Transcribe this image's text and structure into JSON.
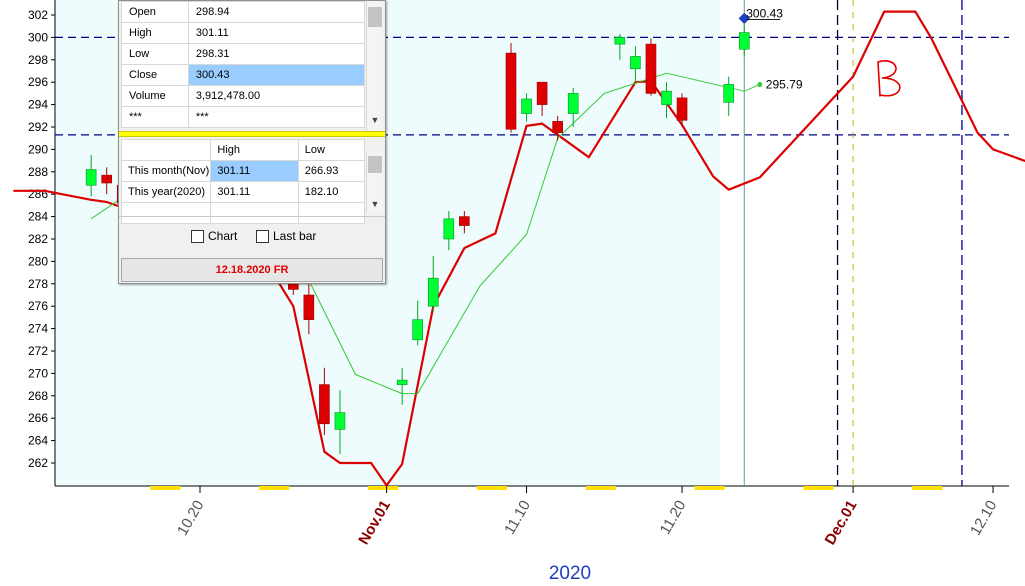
{
  "chart_data": {
    "type": "candlestick",
    "ylim": [
      260,
      302
    ],
    "y_ticks": [
      302,
      300,
      298,
      296,
      294,
      292,
      290,
      288,
      286,
      284,
      282,
      280,
      278,
      276,
      274,
      272,
      270,
      268,
      266,
      264,
      262
    ],
    "x_tick_labels": [
      {
        "label": "10.20",
        "date": "2020-10-20",
        "type": "day"
      },
      {
        "label": "Nov.01",
        "date": "2020-11-01",
        "type": "month"
      },
      {
        "label": "11.10",
        "date": "2020-11-10",
        "type": "day"
      },
      {
        "label": "11.20",
        "date": "2020-11-20",
        "type": "day"
      },
      {
        "label": "Dec.01",
        "date": "2020-12-01",
        "type": "month"
      },
      {
        "label": "12.10",
        "date": "2020-12-10",
        "type": "day"
      }
    ],
    "year_label": "2020",
    "candles": [
      {
        "date": "2020-10-13",
        "open": 286.8,
        "high": 289.5,
        "low": 285.8,
        "close": 288.2,
        "dir": "up"
      },
      {
        "date": "2020-10-14",
        "open": 287.7,
        "high": 288.4,
        "low": 286.0,
        "close": 287.0,
        "dir": "down"
      },
      {
        "date": "2020-10-15",
        "open": 286.8,
        "high": 287.5,
        "low": 284.8,
        "close": 285.2,
        "dir": "down"
      },
      {
        "date": "2020-10-26",
        "open": 279.0,
        "high": 280.5,
        "low": 277.0,
        "close": 277.5,
        "dir": "down"
      },
      {
        "date": "2020-10-27",
        "open": 277.0,
        "high": 278.0,
        "low": 273.5,
        "close": 274.8,
        "dir": "down"
      },
      {
        "date": "2020-10-28",
        "open": 269.0,
        "high": 270.5,
        "low": 264.5,
        "close": 265.5,
        "dir": "down"
      },
      {
        "date": "2020-10-29",
        "open": 265.0,
        "high": 268.5,
        "low": 262.8,
        "close": 266.5,
        "dir": "up"
      },
      {
        "date": "2020-11-02",
        "open": 269.0,
        "high": 270.5,
        "low": 267.2,
        "close": 269.4,
        "dir": "up"
      },
      {
        "date": "2020-11-03",
        "open": 273.0,
        "high": 276.5,
        "low": 272.5,
        "close": 274.8,
        "dir": "up"
      },
      {
        "date": "2020-11-04",
        "open": 276.0,
        "high": 280.5,
        "low": 275.5,
        "close": 278.5,
        "dir": "up"
      },
      {
        "date": "2020-11-05",
        "open": 282.0,
        "high": 284.5,
        "low": 281.0,
        "close": 283.8,
        "dir": "up"
      },
      {
        "date": "2020-11-06",
        "open": 284.0,
        "high": 284.5,
        "low": 282.5,
        "close": 283.2,
        "dir": "down"
      },
      {
        "date": "2020-11-09",
        "open": 298.6,
        "high": 299.5,
        "low": 291.5,
        "close": 291.8,
        "dir": "down"
      },
      {
        "date": "2020-11-10",
        "open": 293.2,
        "high": 295.0,
        "low": 292.5,
        "close": 294.5,
        "dir": "up"
      },
      {
        "date": "2020-11-11",
        "open": 296.0,
        "high": 296.0,
        "low": 293.0,
        "close": 294.0,
        "dir": "down"
      },
      {
        "date": "2020-11-12",
        "open": 292.5,
        "high": 293.0,
        "low": 290.8,
        "close": 291.5,
        "dir": "down"
      },
      {
        "date": "2020-11-13",
        "open": 293.2,
        "high": 295.5,
        "low": 292.0,
        "close": 295.0,
        "dir": "up"
      },
      {
        "date": "2020-11-16",
        "open": 299.4,
        "high": 300.3,
        "low": 298.0,
        "close": 300.0,
        "dir": "up"
      },
      {
        "date": "2020-11-17",
        "open": 297.2,
        "high": 299.2,
        "low": 296.0,
        "close": 298.3,
        "dir": "up"
      },
      {
        "date": "2020-11-18",
        "open": 299.4,
        "high": 299.9,
        "low": 294.8,
        "close": 295.0,
        "dir": "down"
      },
      {
        "date": "2020-11-19",
        "open": 294.0,
        "high": 296.0,
        "low": 292.8,
        "close": 295.2,
        "dir": "up"
      },
      {
        "date": "2020-11-20",
        "open": 294.6,
        "high": 295.0,
        "low": 292.0,
        "close": 292.6,
        "dir": "down"
      },
      {
        "date": "2020-11-23",
        "open": 294.2,
        "high": 296.5,
        "low": 293.0,
        "close": 295.8,
        "dir": "up"
      },
      {
        "date": "2020-11-24",
        "open": 298.94,
        "high": 301.11,
        "low": 298.31,
        "close": 300.43,
        "dir": "up"
      }
    ],
    "moving_average": [
      {
        "date": "2020-10-13",
        "value": 283.8
      },
      {
        "date": "2020-10-15",
        "value": 285.7
      },
      {
        "date": "2020-10-27",
        "value": 278.3
      },
      {
        "date": "2020-10-30",
        "value": 269.9
      },
      {
        "date": "2020-11-02",
        "value": 268.2
      },
      {
        "date": "2020-11-03",
        "value": 268.2
      },
      {
        "date": "2020-11-07",
        "value": 277.8
      },
      {
        "date": "2020-11-10",
        "value": 282.4
      },
      {
        "date": "2020-11-12",
        "value": 291.0
      },
      {
        "date": "2020-11-15",
        "value": 295.0
      },
      {
        "date": "2020-11-19",
        "value": 296.8
      },
      {
        "date": "2020-11-24",
        "value": 295.2
      },
      {
        "date": "2020-11-25",
        "value": 295.79
      }
    ],
    "cycle_projection": [
      {
        "date": "2020-10-08",
        "value": 286.3
      },
      {
        "date": "2020-10-10",
        "value": 286.3
      },
      {
        "date": "2020-10-13",
        "value": 285.5
      },
      {
        "date": "2020-10-14",
        "value": 285.3
      },
      {
        "date": "2020-10-24",
        "value": 280.5
      },
      {
        "date": "2020-10-26",
        "value": 276.0
      },
      {
        "date": "2020-10-28",
        "value": 263.0
      },
      {
        "date": "2020-10-29",
        "value": 262.0
      },
      {
        "date": "2020-10-31",
        "value": 262.0
      },
      {
        "date": "2020-11-01",
        "value": 260.0
      },
      {
        "date": "2020-11-02",
        "value": 261.9
      },
      {
        "date": "2020-11-04",
        "value": 276.0
      },
      {
        "date": "2020-11-06",
        "value": 281.2
      },
      {
        "date": "2020-11-08",
        "value": 282.5
      },
      {
        "date": "2020-11-10",
        "value": 292.1
      },
      {
        "date": "2020-11-11",
        "value": 292.3
      },
      {
        "date": "2020-11-14",
        "value": 289.3
      },
      {
        "date": "2020-11-17",
        "value": 296.0
      },
      {
        "date": "2020-11-18",
        "value": 296.1
      },
      {
        "date": "2020-11-20",
        "value": 292.2
      },
      {
        "date": "2020-11-22",
        "value": 287.6
      },
      {
        "date": "2020-11-23",
        "value": 286.4
      },
      {
        "date": "2020-11-25",
        "value": 287.5
      },
      {
        "date": "2020-11-28",
        "value": 292.0
      },
      {
        "date": "2020-12-01",
        "value": 296.5
      },
      {
        "date": "2020-12-03",
        "value": 302.3
      },
      {
        "date": "2020-12-05",
        "value": 302.3
      },
      {
        "date": "2020-12-06",
        "value": 300.0
      },
      {
        "date": "2020-12-09",
        "value": 291.5
      },
      {
        "date": "2020-12-10",
        "value": 290.0
      },
      {
        "date": "2020-12-13",
        "value": 288.5
      },
      {
        "date": "2020-12-15",
        "value": 286.0
      },
      {
        "date": "2020-12-17",
        "value": 284.0
      },
      {
        "date": "2020-12-18",
        "value": 283.8
      },
      {
        "date": "2020-12-20",
        "value": 284.4
      },
      {
        "date": "2020-12-24",
        "value": 287.0
      }
    ],
    "horizontal_lines": [
      300.0,
      291.3
    ],
    "vertical_lines": [
      "2020-11-24",
      "2020-11-30",
      "2020-12-08"
    ],
    "dashed_vertical_lines": [
      "2020-12-01"
    ],
    "last_close_label": "300.43",
    "ma_label": "295.79",
    "annotation": "B"
  },
  "info_panel": {
    "rows": [
      {
        "label": "Open",
        "value": "298.94"
      },
      {
        "label": "High",
        "value": "301.11"
      },
      {
        "label": "Low",
        "value": "298.31"
      },
      {
        "label": "Close",
        "value": "300.43"
      },
      {
        "label": "Volume",
        "value": "3,912,478.00"
      },
      {
        "label": "***",
        "value": "***"
      }
    ],
    "range_headers": [
      "High",
      "Low"
    ],
    "range_rows": [
      {
        "label": "This month(Nov)",
        "high": "301.11",
        "low": "266.93"
      },
      {
        "label": "This year(2020)",
        "high": "301.11",
        "low": "182.10"
      }
    ],
    "chart_checkbox": "Chart",
    "lastbar_checkbox": "Last bar",
    "date_display": "12.18.2020 FR"
  },
  "colors": {
    "up": "#00ff33",
    "down": "#dd0000",
    "ma": "#33cc33",
    "cycle": "#dd0000",
    "plot_bg": "#eefcfd",
    "grid_dash": "#000088",
    "highlight_row": "#99ccff"
  }
}
